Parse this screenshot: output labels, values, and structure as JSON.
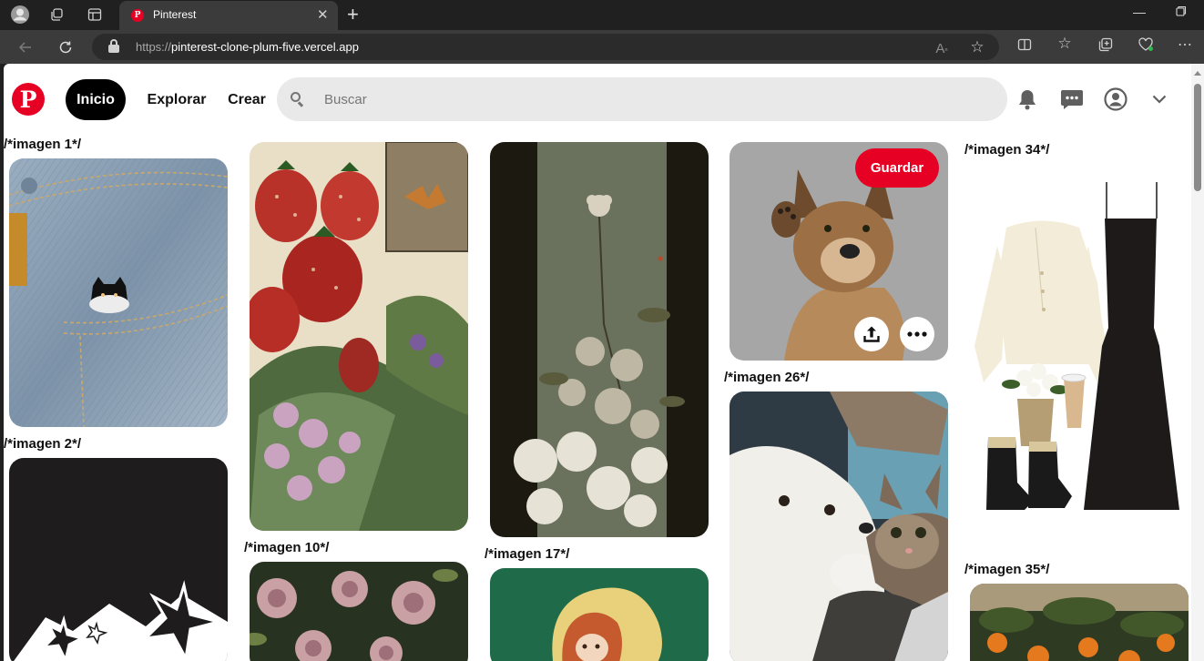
{
  "browser": {
    "tab_title": "Pinterest",
    "url_scheme": "https://",
    "url_host": "pinterest-clone-plum-five.vercel.app"
  },
  "header": {
    "logo_letter": "P",
    "nav": {
      "home": "Inicio",
      "explore": "Explorar",
      "create": "Crear"
    },
    "search_placeholder": "Buscar"
  },
  "pins": {
    "label_1": "/*imagen 1*/",
    "label_2": "/*imagen 2*/",
    "label_10": "/*imagen 10*/",
    "label_17": "/*imagen 17*/",
    "label_26": "/*imagen 26*/",
    "label_34": "/*imagen 34*/",
    "label_35": "/*imagen 35*/",
    "save_label": "Guardar"
  },
  "colors": {
    "brand": "#e60023",
    "nav_active_bg": "#000000",
    "search_bg": "#e9e9e9"
  }
}
